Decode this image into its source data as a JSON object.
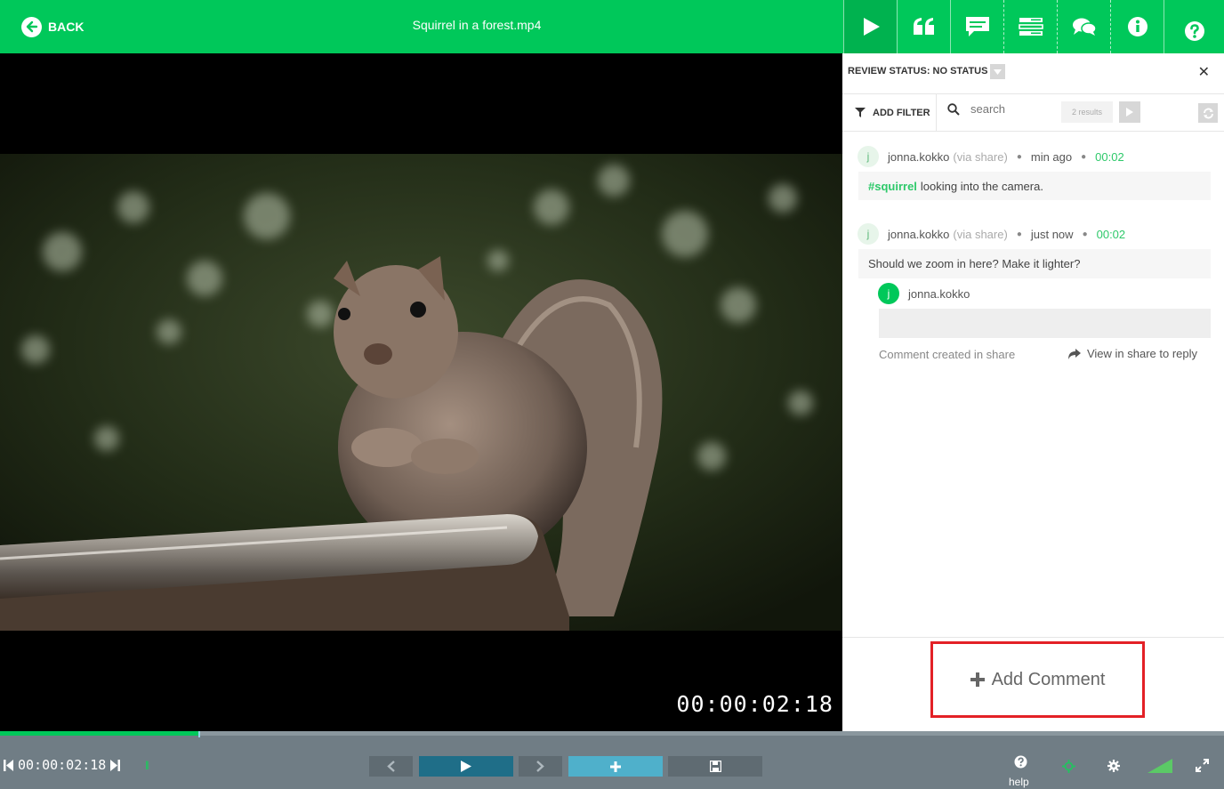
{
  "header": {
    "back_label": "BACK",
    "file_title": "Squirrel in a forest.mp4"
  },
  "toolbar": {
    "icons": [
      "play-icon",
      "quote-icon",
      "comment-icon",
      "list-icon",
      "chat-icon",
      "info-icon",
      "help-icon"
    ]
  },
  "video": {
    "timecode": "00:00:02:18"
  },
  "panel": {
    "review_status": "REVIEW STATUS: NO STATUS",
    "add_filter": "ADD FILTER",
    "search_placeholder": "search",
    "results": "2 results",
    "comments": [
      {
        "avatar": "j",
        "user": "jonna.kokko",
        "via": "(via share)",
        "time": "min ago",
        "timecode": "00:02",
        "tag": "#squirrel",
        "text": "looking into the camera."
      },
      {
        "avatar": "j",
        "user": "jonna.kokko",
        "via": "(via share)",
        "time": "just now",
        "timecode": "00:02",
        "text": "Should we zoom in here? Make it lighter?"
      }
    ],
    "reply": {
      "avatar": "j",
      "user": "jonna.kokko",
      "created_note": "Comment created in share",
      "view_share": "View in share to reply"
    },
    "add_comment": "Add Comment"
  },
  "bottom": {
    "timecode": "00:00:02:18",
    "progress": 0.163,
    "help_label": "help"
  },
  "colors": {
    "brand_green": "#00c85a",
    "bar_grey": "#707d85",
    "play_teal": "#1f6e88",
    "add_teal": "#4fb0cb",
    "highlight_red": "#e32126"
  }
}
